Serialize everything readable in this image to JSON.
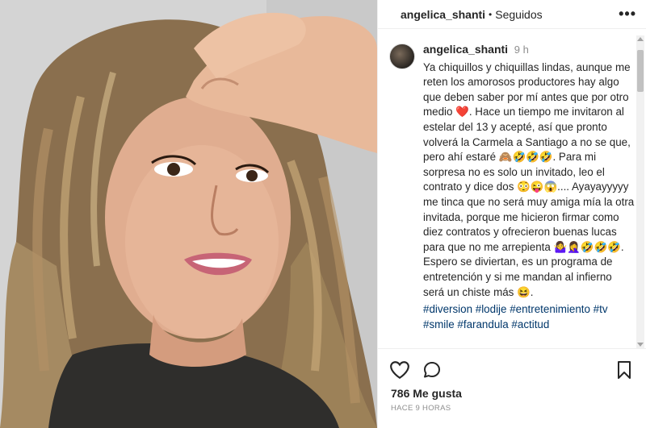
{
  "post": {
    "username": "angelica_shanti",
    "separator": "•",
    "follow_status": "Seguidos",
    "more_icon": "more-horizontal-icon"
  },
  "caption": {
    "username": "angelica_shanti",
    "time": "9 h",
    "text": "Ya chiquillos y chiquillas lindas, aunque me reten los amorosos productores hay algo que deben saber por mí antes que por otro medio ❤️. Hace un tiempo me invitaron al estelar del 13 y acepté, así que pronto volverá la Carmela a Santiago a no se que, pero ahí estaré 🙈🤣🤣🤣. Para mi sorpresa no es solo un invitado, leo el contrato y dice dos 😳😜😱.... Ayayayyyyy me tinca que no será muy amiga mía la otra invitada, porque me hicieron firmar como diez contratos y ofrecieron buenas lucas para que no me arrepienta 🤷‍♀️🤦‍♀️🤣🤣🤣. Espero se diviertan, es un programa de entretención y si me mandan al infierno será un chiste más 😆.",
    "hashtags": "#diversion #lodije #entretenimiento #tv #smile #farandula #actitud"
  },
  "actions": {
    "like_icon": "heart-icon",
    "comment_icon": "comment-icon",
    "save_icon": "bookmark-icon",
    "likes": "786 Me gusta",
    "time_ago": "HACE 9 HORAS"
  },
  "colors": {
    "text": "#262626",
    "secondary": "#8e8e8e",
    "hashtag": "#00376b"
  }
}
